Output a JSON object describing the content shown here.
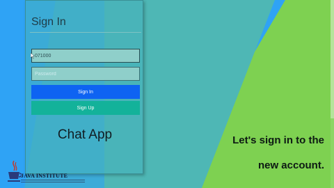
{
  "login": {
    "title": "Sign In",
    "username_value": "071000",
    "password_placeholder": "Password",
    "signin_label": "Sign In",
    "signup_label": "Sign Up",
    "app_name": "Chat App"
  },
  "logo": {
    "text": "JAVA INSTITUTE"
  },
  "caption": {
    "line1": "Let's sign in to the",
    "line2": "new account."
  },
  "colors": {
    "signin_button": "#0e63f2",
    "signup_button": "#13b29a",
    "background_blue": "#2fa3f5",
    "background_teal": "#4eb7b5",
    "background_green": "#7ed151"
  },
  "icons": {
    "cursor": "mouse-pointer-icon",
    "logo": "java-cup-icon"
  }
}
